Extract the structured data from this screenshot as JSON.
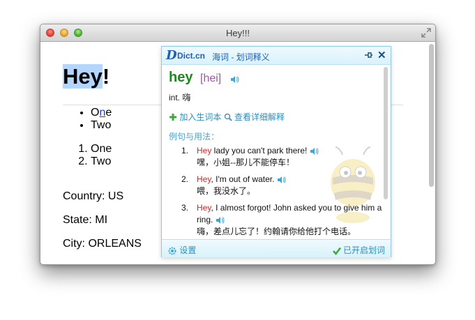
{
  "window": {
    "title": "Hey!!!"
  },
  "page": {
    "heading": "Hey!",
    "heading_selected": "Hey",
    "heading_rest": "!",
    "bullet_items": [
      "One",
      "Two"
    ],
    "bullet_link_parts": [
      "O",
      "n",
      "e"
    ],
    "numbered_items": [
      "One",
      "Two"
    ],
    "country": "Country: US",
    "state": "State: MI",
    "city": "City: ORLEANS"
  },
  "popup": {
    "logo": "Dict.cn",
    "logo_suffix": "海词 - 划词释义",
    "word": "hey",
    "phonetic": "[hei]",
    "definition": "int. 嗨",
    "add_wordbook": "加入生词本",
    "view_detail": "查看详细解释",
    "section_title": "例句与用法：",
    "examples": [
      {
        "num": "1.",
        "hl": "Hey",
        "en": " lady you can't park there!",
        "zh": "嘿，小姐--那儿不能停车！"
      },
      {
        "num": "2.",
        "hl": "Hey",
        "en": ", I'm out of water.",
        "zh": "喂，我没水了。"
      },
      {
        "num": "3.",
        "hl": "Hey",
        "en": ", I almost forgot! John asked you to give him a ring.",
        "zh": "嗨，差点儿忘了！约翰请你给他打个电话。"
      }
    ],
    "settings_label": "设置",
    "enabled_label": "已开启划词",
    "accent_color": "#1e5fb8",
    "highlight_color": "#e02020",
    "word_color": "#1d8a1d",
    "icons": [
      "pin-icon",
      "close-icon",
      "speaker-icon",
      "plus-icon",
      "search-icon",
      "gear-icon",
      "check-icon",
      "bee-mascot"
    ]
  }
}
